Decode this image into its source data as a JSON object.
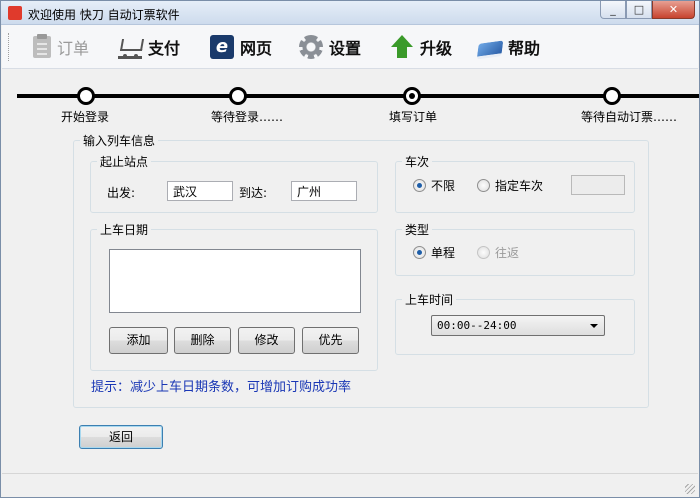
{
  "window": {
    "title": "欢迎使用 快刀 自动订票软件",
    "icons": {
      "minimize": "minimize-icon",
      "maximize": "maximize-icon",
      "close": "close-icon"
    }
  },
  "toolbar": {
    "items": [
      {
        "label": "订单",
        "icon": "clipboard-icon",
        "enabled": false
      },
      {
        "label": "支付",
        "icon": "cart-icon",
        "enabled": true
      },
      {
        "label": "网页",
        "icon": "ie-browser-icon",
        "enabled": true
      },
      {
        "label": "设置",
        "icon": "gear-icon",
        "enabled": true
      },
      {
        "label": "升级",
        "icon": "up-arrow-icon",
        "enabled": true
      },
      {
        "label": "帮助",
        "icon": "book-icon",
        "enabled": true
      }
    ]
  },
  "steps": [
    {
      "label": "开始登录",
      "state": "done"
    },
    {
      "label": "等待登录……",
      "state": "done"
    },
    {
      "label": "填写订单",
      "state": "current"
    },
    {
      "label": "等待自动订票……",
      "state": "pending"
    }
  ],
  "train_info": {
    "legend": "输入列车信息",
    "stations": {
      "legend": "起止站点",
      "from_label": "出发:",
      "from_value": "武汉",
      "to_label": "到达:",
      "to_value": "广州"
    },
    "date": {
      "legend": "上车日期",
      "buttons": {
        "add": "添加",
        "delete": "删除",
        "modify": "修改",
        "priority": "优先"
      }
    },
    "train_no": {
      "legend": "车次",
      "options": {
        "any": "不限",
        "specified": "指定车次"
      },
      "selected": "不限",
      "value": ""
    },
    "trip_type": {
      "legend": "类型",
      "options": {
        "one_way": "单程",
        "round_trip": "往返"
      },
      "selected": "单程",
      "round_trip_enabled": false
    },
    "time": {
      "legend": "上车时间",
      "selected": "00:00--24:00"
    },
    "hint": "提示：减少上车日期条数，可增加订购成功率"
  },
  "back_button": "返回",
  "colors": {
    "hint": "#1a37b5",
    "track": "#000000",
    "title_bar": "#cddbed",
    "close_button": "#c7432e"
  }
}
